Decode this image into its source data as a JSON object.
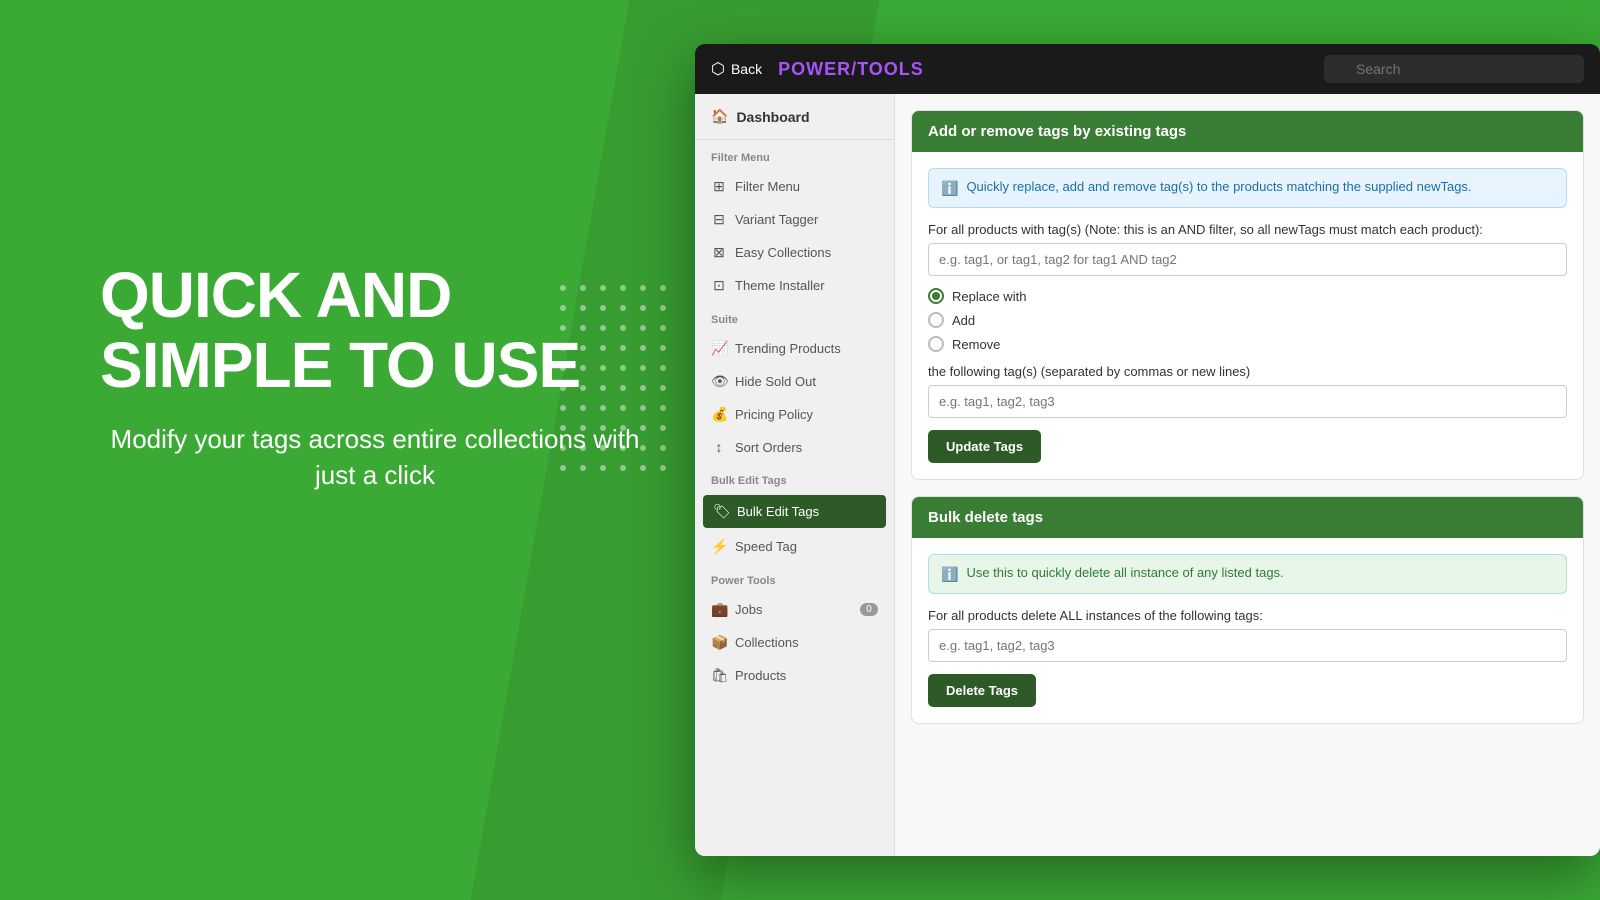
{
  "background": {
    "color": "#3aaa35"
  },
  "hero": {
    "title_line1": "QUICK AND",
    "title_line2": "SIMPLE TO USE",
    "subtitle": "Modify your tags across entire collections with just a click"
  },
  "topbar": {
    "back_label": "Back",
    "brand_name": "POWER",
    "brand_accent": "/",
    "brand_suffix": "TOOLS",
    "search_placeholder": "Search"
  },
  "sidebar": {
    "dashboard_label": "Dashboard",
    "filter_menu_section": "Filter Menu",
    "filter_menu_items": [
      {
        "label": "Filter Menu",
        "icon": "⊞"
      },
      {
        "label": "Variant Tagger",
        "icon": "⊟"
      },
      {
        "label": "Easy Collections",
        "icon": "⊠"
      },
      {
        "label": "Theme Installer",
        "icon": "⊡"
      }
    ],
    "suite_section": "Suite",
    "suite_items": [
      {
        "label": "Trending Products",
        "icon": "📈"
      },
      {
        "label": "Hide Sold Out",
        "icon": "👁"
      },
      {
        "label": "Pricing Policy",
        "icon": "💰"
      },
      {
        "label": "Sort Orders",
        "icon": "↕"
      }
    ],
    "bulk_edit_tags_section": "Bulk Edit Tags",
    "bulk_edit_items": [
      {
        "label": "Bulk Edit Tags",
        "icon": "🏷",
        "active": true
      },
      {
        "label": "Speed Tag",
        "icon": "⚡",
        "active": false
      }
    ],
    "power_tools_section": "Power Tools",
    "power_tools_items": [
      {
        "label": "Jobs",
        "icon": "💼",
        "badge": "0"
      },
      {
        "label": "Collections",
        "icon": "📦"
      },
      {
        "label": "Products",
        "icon": "🛍"
      }
    ]
  },
  "main": {
    "add_remove_card": {
      "header": "Add or remove tags by existing tags",
      "info_text": "Quickly replace, add and remove tag(s) to the products matching the supplied newTags.",
      "filter_label": "For all products with tag(s) (Note: this is an AND filter, so all newTags must match each product):",
      "filter_placeholder": "e.g. tag1, or tag1, tag2 for tag1 AND tag2",
      "radio_options": [
        {
          "label": "Replace with",
          "selected": true
        },
        {
          "label": "Add",
          "selected": false
        },
        {
          "label": "Remove",
          "selected": false
        }
      ],
      "tags_label": "the following tag(s) (separated by commas or new lines)",
      "tags_placeholder": "e.g. tag1, tag2, tag3",
      "update_button": "Update Tags"
    },
    "bulk_delete_card": {
      "header": "Bulk delete tags",
      "info_text": "Use this to quickly delete all instance of any listed tags.",
      "delete_label": "For all products delete ALL instances of the following tags:",
      "delete_placeholder": "e.g. tag1, tag2, tag3",
      "delete_button": "Delete Tags"
    }
  }
}
